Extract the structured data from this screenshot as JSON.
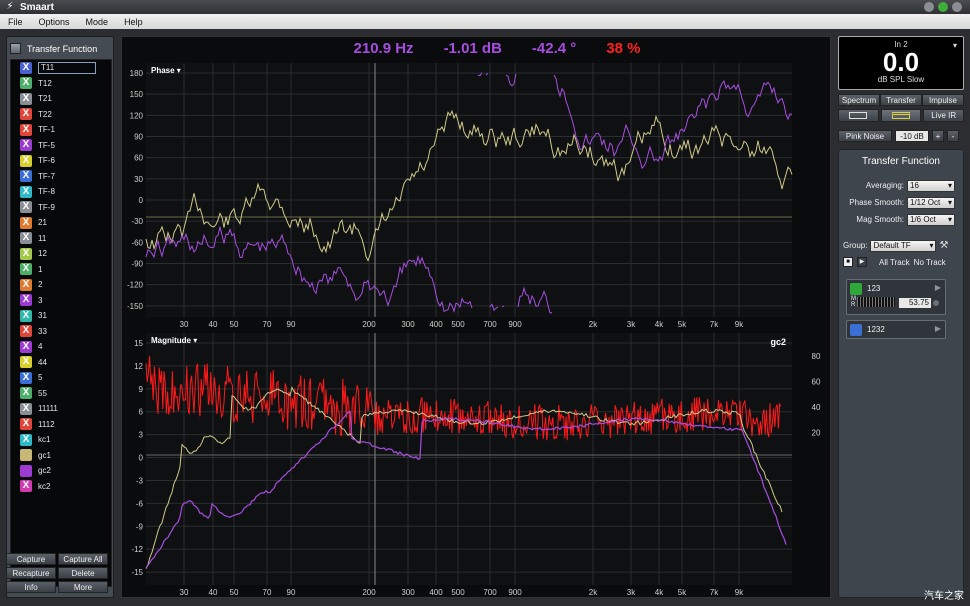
{
  "app": {
    "title": "Smaart"
  },
  "menu": [
    "File",
    "Options",
    "Mode",
    "Help"
  ],
  "left": {
    "header": "Transfer Function",
    "items": [
      {
        "label": "T11",
        "color": "#4a5fd0",
        "kind": "x",
        "selected": true
      },
      {
        "label": "T12",
        "color": "#4caf6a",
        "kind": "x"
      },
      {
        "label": "T21",
        "color": "#8a8f96",
        "kind": "x"
      },
      {
        "label": "T22",
        "color": "#e0453a",
        "kind": "x"
      },
      {
        "label": "TF-1",
        "color": "#e0453a",
        "kind": "x"
      },
      {
        "label": "TF-5",
        "color": "#9b3bd0",
        "kind": "x"
      },
      {
        "label": "TF-6",
        "color": "#d6cf2e",
        "kind": "x"
      },
      {
        "label": "TF-7",
        "color": "#3b6fd6",
        "kind": "x"
      },
      {
        "label": "TF-8",
        "color": "#2fb8c8",
        "kind": "x"
      },
      {
        "label": "TF-9",
        "color": "#8a8f96",
        "kind": "x"
      },
      {
        "label": "21",
        "color": "#e07a30",
        "kind": "x"
      },
      {
        "label": "11",
        "color": "#8a8f96",
        "kind": "x"
      },
      {
        "label": "12",
        "color": "#a4c84a",
        "kind": "x"
      },
      {
        "label": "1",
        "color": "#4caf6a",
        "kind": "x"
      },
      {
        "label": "2",
        "color": "#e07a30",
        "kind": "x"
      },
      {
        "label": "3",
        "color": "#9b3bd0",
        "kind": "x"
      },
      {
        "label": "31",
        "color": "#2fb8a8",
        "kind": "x"
      },
      {
        "label": "33",
        "color": "#e0453a",
        "kind": "x"
      },
      {
        "label": "4",
        "color": "#9b3bd0",
        "kind": "x"
      },
      {
        "label": "44",
        "color": "#d6cf2e",
        "kind": "x"
      },
      {
        "label": "5",
        "color": "#3b6fd6",
        "kind": "x"
      },
      {
        "label": "55",
        "color": "#4caf6a",
        "kind": "x"
      },
      {
        "label": "11111",
        "color": "#8a8f96",
        "kind": "x"
      },
      {
        "label": "1112",
        "color": "#e0453a",
        "kind": "x"
      },
      {
        "label": "kc1",
        "color": "#2fb8c8",
        "kind": "x"
      },
      {
        "label": "gc1",
        "color": "#c8b878",
        "kind": "sq"
      },
      {
        "label": "gc2",
        "color": "#9b3bd0",
        "kind": "sq"
      },
      {
        "label": "kc2",
        "color": "#d03bb0",
        "kind": "x"
      }
    ],
    "buttons": [
      "Capture",
      "Capture All",
      "Recapture",
      "Delete",
      "Info",
      "More"
    ]
  },
  "readout": {
    "freq": "210.9 Hz",
    "mag": "-1.01 dB",
    "phase": "-42.4 °",
    "coherence": "38 %"
  },
  "phase_plot": {
    "label": "Phase ▾",
    "y_ticks": [
      "180",
      "150",
      "120",
      "90",
      "60",
      "30",
      "0",
      "-30",
      "-60",
      "-90",
      "-120",
      "-150"
    ],
    "x_ticks": [
      "30",
      "40",
      "50",
      "70",
      "90",
      "200",
      "300",
      "400",
      "500",
      "700",
      "900",
      "2k",
      "3k",
      "4k",
      "5k",
      "7k",
      "9k"
    ]
  },
  "mag_plot": {
    "label": "Magnitude ▾",
    "trace_name": "gc2",
    "y_ticks": [
      "15",
      "12",
      "9",
      "6",
      "3",
      "0",
      "-3",
      "-6",
      "-9",
      "-12",
      "-15"
    ],
    "y2_ticks": [
      "80",
      "60",
      "40",
      "20"
    ],
    "x_ticks": [
      "30",
      "40",
      "50",
      "70",
      "90",
      "200",
      "300",
      "400",
      "500",
      "700",
      "900",
      "2k",
      "3k",
      "4k",
      "5k",
      "7k",
      "9k"
    ]
  },
  "meter": {
    "channel": "In 2",
    "value": "0.0",
    "unit": "dB SPL Slow"
  },
  "modes": [
    "Spectrum",
    "Transfer",
    "Impulse"
  ],
  "view": {
    "live_ir": "Live IR"
  },
  "generator": {
    "label": "Pink Noise",
    "level": "-10 dB",
    "plus": "+",
    "minus": "-"
  },
  "tf_panel": {
    "title": "Transfer Function",
    "averaging_label": "Averaging:",
    "averaging": "16",
    "phase_smooth_label": "Phase Smooth:",
    "phase_smooth": "1/12 Oct",
    "mag_smooth_label": "Mag Smooth:",
    "mag_smooth": "1/6 Oct",
    "group_label": "Group:",
    "group": "Default TF",
    "all_track": "All Track",
    "no_track": "No Track",
    "measurements": [
      {
        "name": "123",
        "color": "#2fa83a",
        "meter_m": "M",
        "meter_r": "R",
        "delay": "53.75"
      },
      {
        "name": "1232",
        "color": "#3b6fd6"
      }
    ]
  },
  "watermark": "汽车之家",
  "colors": {
    "purple": "#a64ee0",
    "red": "#ff1a1a",
    "yellow": "#cfc98a",
    "grid": "#2a2d31"
  }
}
